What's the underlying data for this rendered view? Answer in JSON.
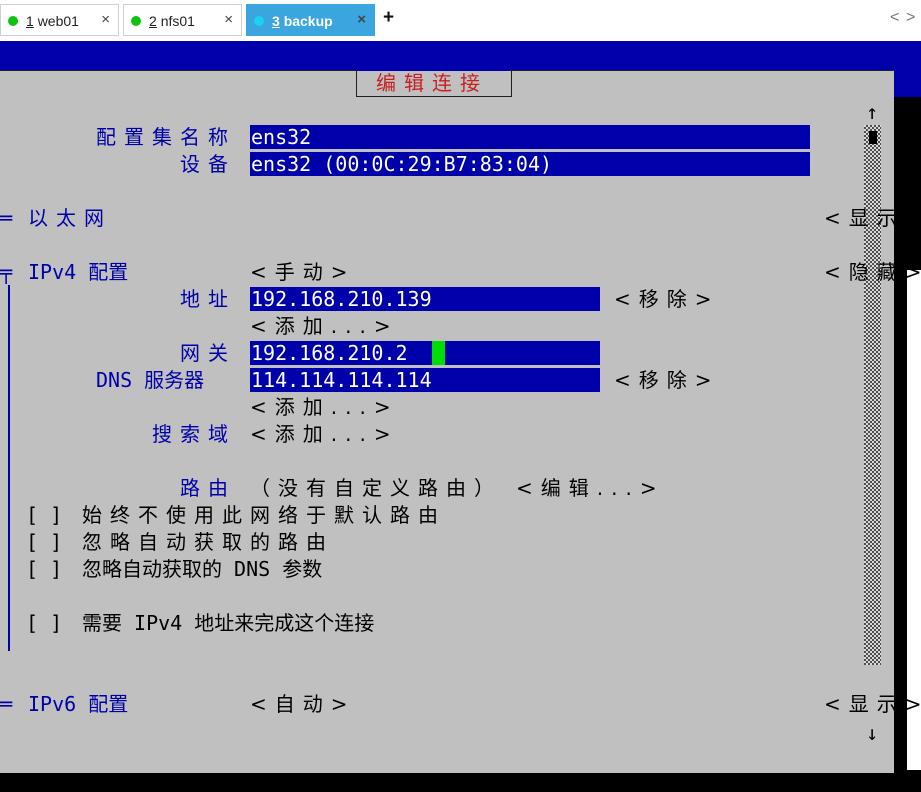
{
  "tabs": [
    {
      "num": "1",
      "name": "web01",
      "close": "×",
      "active": false
    },
    {
      "num": "2",
      "name": "nfs01",
      "close": "×",
      "active": false
    },
    {
      "num": "3",
      "name": "backup",
      "close": "×",
      "active": true
    }
  ],
  "new_tab": "+",
  "nav_prev": "<",
  "nav_next": ">",
  "dialog": {
    "title": "编辑连接",
    "profile_name_label": "配置集名称",
    "profile_name_value": "ens32",
    "device_label": "设备",
    "device_value": "ens32 (00:0C:29:B7:83:04)",
    "ethernet": {
      "label": "以太网",
      "marker": "═",
      "toggle": "<显示>"
    },
    "ipv4": {
      "label": "IPv4 配置",
      "marker": "╤",
      "method": "<手动>",
      "toggle": "<隐藏>",
      "address_label": "地址",
      "address_value": "192.168.210.139",
      "remove_1": "<移除>",
      "add_address": "<添加...>",
      "gateway_label": "网关",
      "gateway_value": "192.168.210.2",
      "dns_label": "DNS 服务器",
      "dns_value": "114.114.114.114",
      "remove_2": "<移除>",
      "add_dns": "<添加...>",
      "search_label": "搜索域",
      "add_search": "<添加...>",
      "routing_label": "路由",
      "routing_value": "（没有自定义路由）",
      "routing_edit": "<编辑...>",
      "checkbox_mark": "[ ]",
      "never_default": "始终不使用此网络于默认路由",
      "ignore_routes": "忽略自动获取的路由",
      "ignore_dns": "忽略自动获取的 DNS 参数",
      "require_ipv4": "需要 IPv4 地址来完成这个连接"
    },
    "ipv6": {
      "label": "IPv6 配置",
      "marker": "═",
      "method": "<自动>",
      "toggle": "<显示>"
    },
    "scroll_up": "↑",
    "scroll_down": "↓"
  }
}
